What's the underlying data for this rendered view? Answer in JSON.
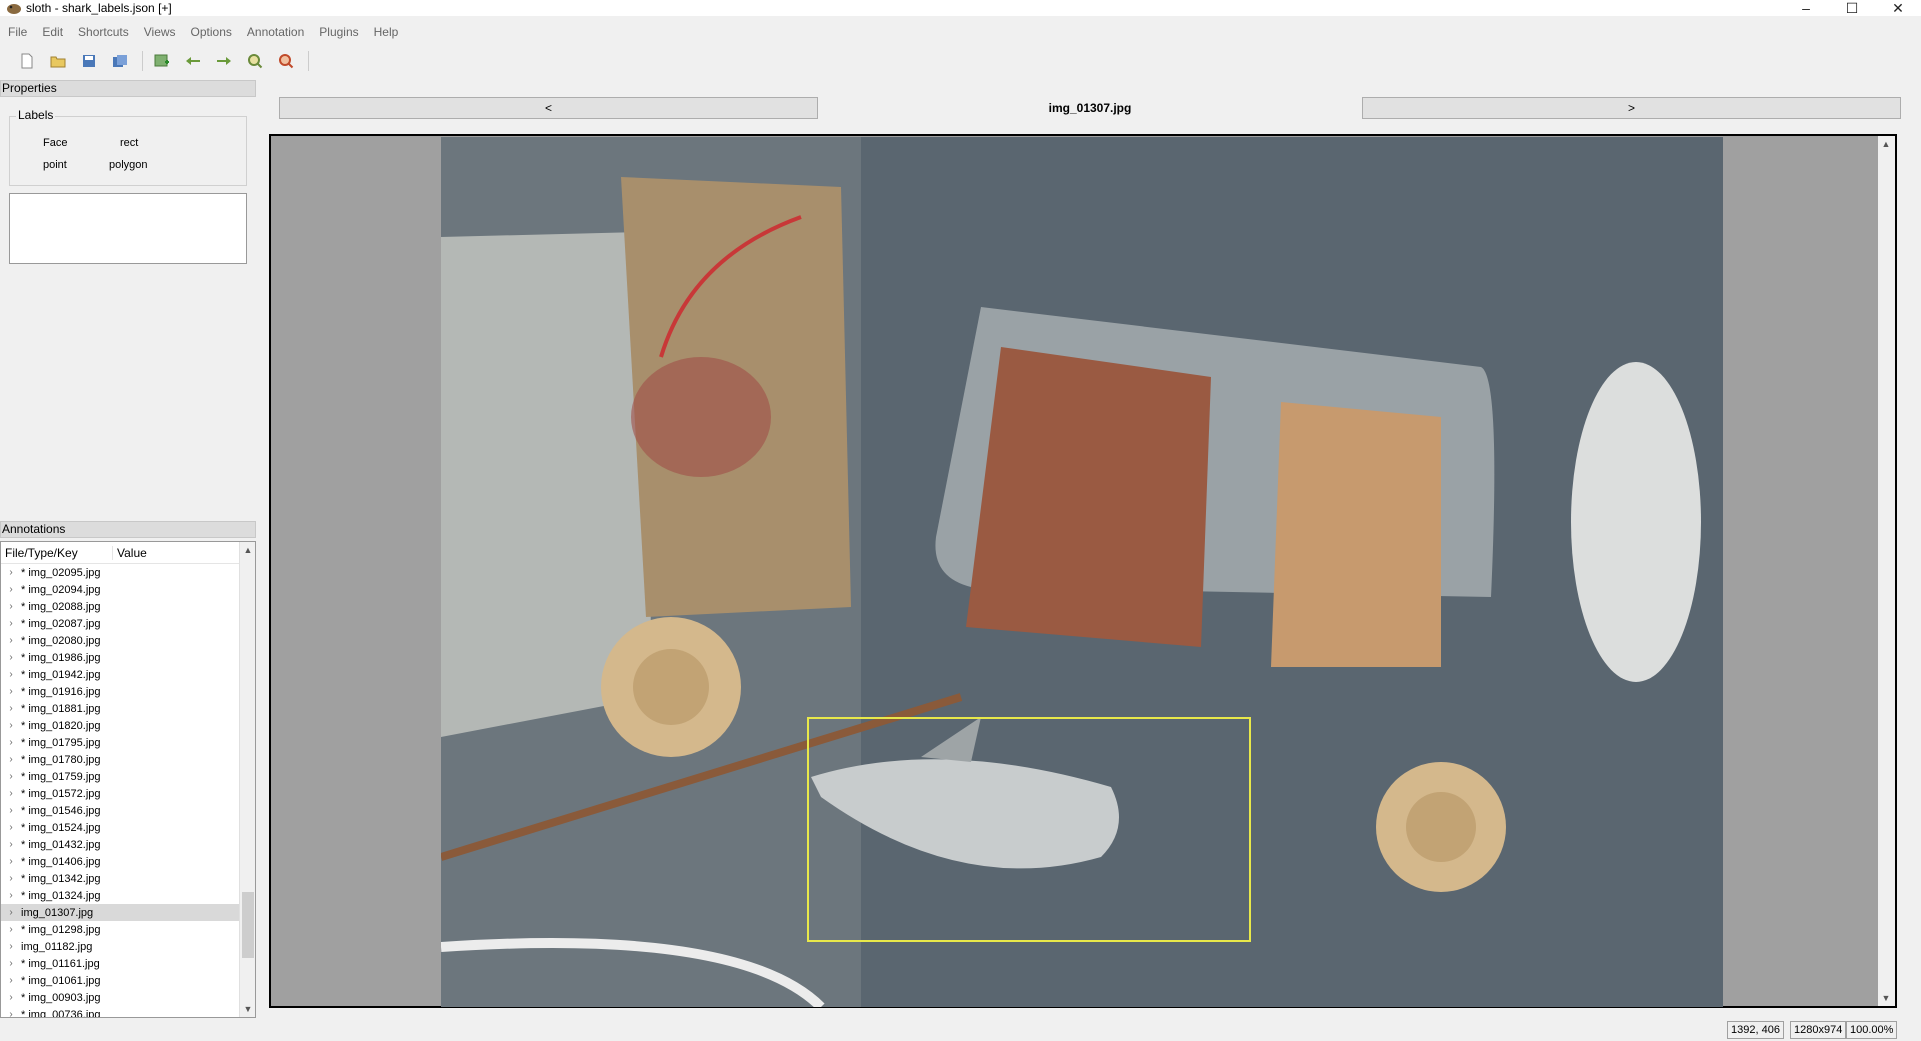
{
  "window": {
    "title": "sloth - shark_labels.json [+]",
    "minimize": "–",
    "maximize": "☐",
    "close": "✕"
  },
  "menu": [
    "File",
    "Edit",
    "Shortcuts",
    "Views",
    "Options",
    "Annotation",
    "Plugins",
    "Help"
  ],
  "toolbar": {
    "icons": [
      "new-file-icon",
      "open-folder-icon",
      "save-icon",
      "save-as-icon",
      "add-image-icon",
      "previous-arrow-icon",
      "next-arrow-icon",
      "zoom-in-icon",
      "zoom-out-icon"
    ]
  },
  "properties": {
    "title": "Properties",
    "labels_title": "Labels",
    "labels": [
      "Face",
      "rect",
      "point",
      "polygon"
    ]
  },
  "annotations": {
    "title": "Annotations",
    "col_file": "File/Type/Key",
    "col_value": "Value",
    "files": [
      "* img_02095.jpg",
      "* img_02094.jpg",
      "* img_02088.jpg",
      "* img_02087.jpg",
      "* img_02080.jpg",
      "* img_01986.jpg",
      "* img_01942.jpg",
      "* img_01916.jpg",
      "* img_01881.jpg",
      "* img_01820.jpg",
      "* img_01795.jpg",
      "* img_01780.jpg",
      "* img_01759.jpg",
      "* img_01572.jpg",
      "* img_01546.jpg",
      "* img_01524.jpg",
      "* img_01432.jpg",
      "* img_01406.jpg",
      "* img_01342.jpg",
      "* img_01324.jpg",
      "img_01307.jpg",
      "* img_01298.jpg",
      "img_01182.jpg",
      "* img_01161.jpg",
      "* img_01061.jpg",
      "* img_00903.jpg",
      "* img_00736.jpg"
    ],
    "selected_index": 20
  },
  "viewer": {
    "prev_label": "<",
    "next_label": ">",
    "image_name": "img_01307.jpg"
  },
  "status": {
    "coords": "1392, 406",
    "size": "1280x974",
    "zoom": "100.00%"
  },
  "colors": {
    "annotation_box": "#e8e84a",
    "accent_red": "#b03030"
  }
}
